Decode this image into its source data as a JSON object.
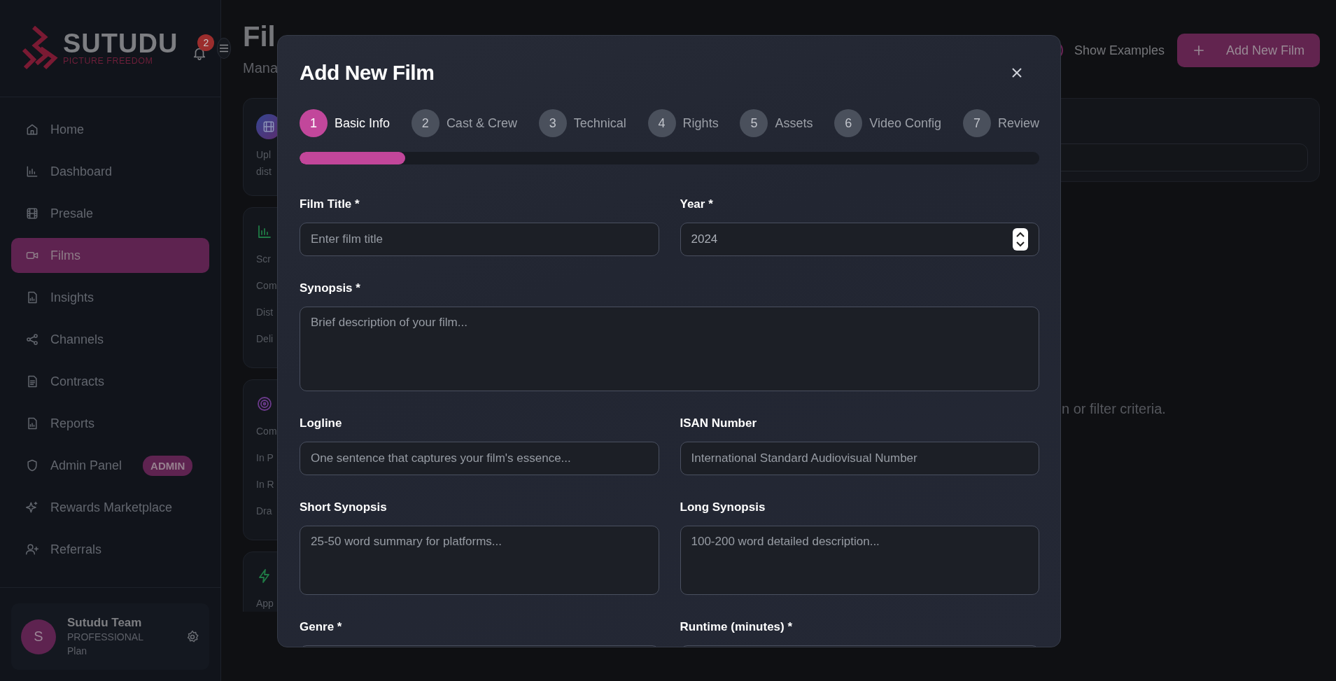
{
  "sidebar": {
    "logo": {
      "name": "SUTUDU",
      "tagline": "PICTURE FREEDOM"
    },
    "notifications": {
      "count": "2"
    },
    "items": [
      {
        "label": "Home",
        "selected": false
      },
      {
        "label": "Dashboard",
        "selected": false
      },
      {
        "label": "Presale",
        "selected": false
      },
      {
        "label": "Films",
        "selected": true
      },
      {
        "label": "Insights",
        "selected": false
      },
      {
        "label": "Channels",
        "selected": false
      },
      {
        "label": "Contracts",
        "selected": false
      },
      {
        "label": "Reports",
        "selected": false
      },
      {
        "label": "Admin Panel",
        "selected": false,
        "badge": "ADMIN"
      },
      {
        "label": "Rewards Marketplace",
        "selected": false
      },
      {
        "label": "Referrals",
        "selected": false
      }
    ],
    "user": {
      "initial": "S",
      "name": "Sutudu Team",
      "plan": "PROFESSIONAL Plan"
    }
  },
  "header": {
    "title": "Fil",
    "subtitle": "Mana",
    "show_examples_on": false,
    "show_examples": "Show Examples",
    "add_button": "Add New Film"
  },
  "cards": [
    {
      "lines": [
        "Upl",
        "dist"
      ]
    },
    {
      "lines": [
        "Scr",
        "Com",
        "Dist",
        "Deli"
      ]
    },
    {
      "lines": [
        "Com",
        "In P",
        "In R",
        "Dra"
      ]
    },
    {
      "lines": [
        "App"
      ]
    }
  ],
  "empty_message": "n or filter criteria.",
  "modal": {
    "title": "Add New Film",
    "steps": [
      {
        "number": "1",
        "label": "Basic Info",
        "selected": true
      },
      {
        "number": "2",
        "label": "Cast & Crew",
        "selected": false
      },
      {
        "number": "3",
        "label": "Technical",
        "selected": false
      },
      {
        "number": "4",
        "label": "Rights",
        "selected": false
      },
      {
        "number": "5",
        "label": "Assets",
        "selected": false
      },
      {
        "number": "6",
        "label": "Video Config",
        "selected": false
      },
      {
        "number": "7",
        "label": "Review",
        "selected": false
      }
    ],
    "progress": {
      "level": 0.143
    },
    "fields": [
      {
        "kind": "input",
        "label": "Film Title *",
        "placeholder": "Enter film title"
      },
      {
        "kind": "number",
        "label": "Year *",
        "value": "2024"
      },
      {
        "kind": "textarea_full",
        "label": "Synopsis *",
        "placeholder": "Brief description of your film..."
      },
      {
        "kind": "input",
        "label": "Logline",
        "placeholder": "One sentence that captures your film's essence..."
      },
      {
        "kind": "input",
        "label": "ISAN Number",
        "placeholder": "International Standard Audiovisual Number"
      },
      {
        "kind": "textarea",
        "label": "Short Synopsis",
        "placeholder": "25-50 word summary for platforms..."
      },
      {
        "kind": "textarea",
        "label": "Long Synopsis",
        "placeholder": "100-200 word detailed description..."
      },
      {
        "kind": "input",
        "label": "Genre *"
      },
      {
        "kind": "input",
        "label": "Runtime (minutes) *"
      }
    ]
  }
}
